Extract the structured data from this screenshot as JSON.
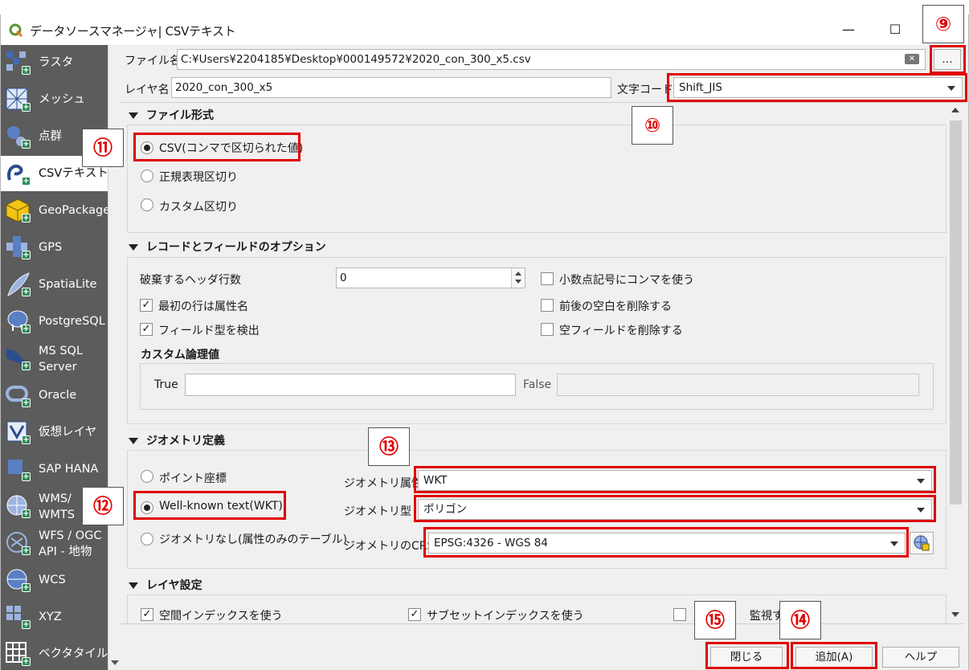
{
  "window": {
    "title": "データソースマネージャ| CSVテキスト",
    "minimize": "—",
    "maximize": "☐"
  },
  "sidebar": {
    "items": [
      {
        "label": "ラスタ"
      },
      {
        "label": "メッシュ"
      },
      {
        "label": "点群"
      },
      {
        "label": "CSVテキスト"
      },
      {
        "label": "GeoPackage"
      },
      {
        "label": "GPS"
      },
      {
        "label": "SpatiaLite"
      },
      {
        "label": "PostgreSQL"
      },
      {
        "label": "MS SQL\nServer"
      },
      {
        "label": "Oracle"
      },
      {
        "label": "仮想レイヤ"
      },
      {
        "label": "SAP HANA"
      },
      {
        "label": "WMS/\nWMTS"
      },
      {
        "label": "WFS / OGC\nAPI - 地物"
      },
      {
        "label": "WCS"
      },
      {
        "label": "XYZ"
      },
      {
        "label": "ベクタタイル"
      }
    ]
  },
  "file": {
    "label": "ファイル名",
    "value": "C:¥Users¥2204185¥Desktop¥000149572¥2020_con_300_x5.csv",
    "browse": "…"
  },
  "layer": {
    "label": "レイヤ名",
    "value": "2020_con_300_x5",
    "encoding_label": "文字コード",
    "encoding_value": "Shift_JIS"
  },
  "file_format": {
    "header": "ファイル形式",
    "options": [
      "CSV(コンマで区切られた値)",
      "正規表現区切り",
      "カスタム区切り"
    ]
  },
  "record_options": {
    "header": "レコードとフィールドのオプション",
    "discard_label": "破棄するヘッダ行数",
    "discard_value": "0",
    "first_row": "最初の行は属性名",
    "detect_types": "フィールド型を検出",
    "decimal_comma": "小数点記号にコンマを使う",
    "trim": "前後の空白を削除する",
    "discard_empty": "空フィールドを削除する",
    "custom_bool": "カスタム論理値",
    "true_label": "True",
    "false_label": "False"
  },
  "geometry": {
    "header": "ジオメトリ定義",
    "options": [
      "ポイント座標",
      "Well-known text(WKT)",
      "ジオメトリなし(属性のみのテーブル)"
    ],
    "field_label": "ジオメトリ属性",
    "field_value": "WKT",
    "type_label": "ジオメトリ型",
    "type_value": "ポリゴン",
    "crs_label": "ジオメトリのCRS",
    "crs_value": "EPSG:4326 - WGS 84"
  },
  "layer_settings": {
    "header": "レイヤ設定",
    "spatial_index": "空間インデックスを使う",
    "subset_index": "サブセットインデックスを使う",
    "watch": "監視する"
  },
  "buttons": {
    "close": "閉じる",
    "add": "追加(A)",
    "help": "ヘルプ"
  },
  "callouts": [
    "⑨",
    "⑩",
    "⑪",
    "⑫",
    "⑬",
    "⑭",
    "⑮"
  ],
  "colors": {
    "highlight": "#e00000",
    "sidebar_bg": "#5c5c5c"
  }
}
